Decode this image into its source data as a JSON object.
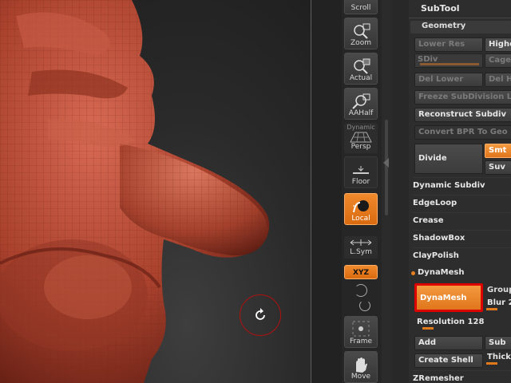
{
  "shelf": {
    "scroll": "Scroll",
    "zoom": "Zoom",
    "actual": "Actual",
    "aahalf": "AAHalf",
    "persp_top": "Dynamic",
    "persp": "Persp",
    "floor": "Floor",
    "local": "Local",
    "lsym": "L.Sym",
    "xyz": "XYZ",
    "frame": "Frame",
    "move": "Move"
  },
  "palette": {
    "subtool": "SubTool",
    "geometry": "Geometry",
    "lower_res": "Lower Res",
    "higher": "Highe",
    "sdiv": "SDiv",
    "cage": "Cage",
    "del_lower": "Del Lower",
    "del_higher": "Del H",
    "freeze": "Freeze SubDivision L",
    "reconstruct": "Reconstruct Subdiv",
    "convert_bpr": "Convert BPR To Geo",
    "divide": "Divide",
    "smt": "Smt",
    "suv": "Suv",
    "dynamic_subdiv": "Dynamic Subdiv",
    "edgeloop": "EdgeLoop",
    "crease": "Crease",
    "shadowbox": "ShadowBox",
    "claypolish": "ClayPolish",
    "dynamesh_header": "DynaMesh",
    "dynamesh_btn": "DynaMesh",
    "groups": "Group",
    "blur": "Blur 2",
    "resolution": "Resolution 128",
    "add": "Add",
    "sub": "Sub",
    "create_shell": "Create Shell",
    "thick": "Thick",
    "zremesher": "ZRemesher"
  },
  "colors": {
    "accent": "#e8801f",
    "highlight_border": "#dd0000",
    "clay": "#a9412d"
  }
}
